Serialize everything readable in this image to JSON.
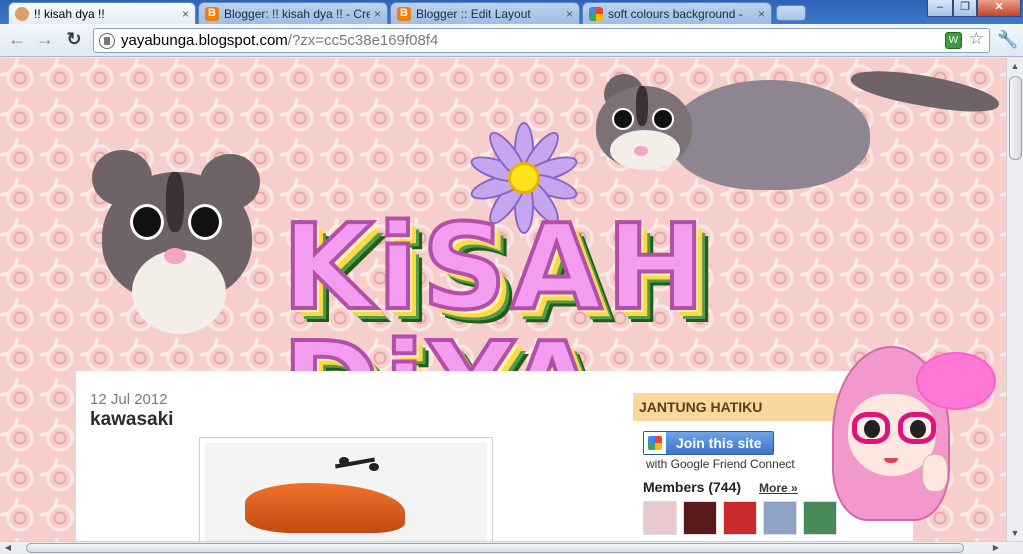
{
  "browser": {
    "tabs": [
      {
        "title": "!! kisah dya !!",
        "icon": "gnome-favicon",
        "active": true
      },
      {
        "title": "Blogger: !! kisah dya !! - Cre",
        "icon": "blogger-favicon",
        "active": false
      },
      {
        "title": "Blogger :: Edit Layout",
        "icon": "blogger-favicon",
        "active": false
      },
      {
        "title": "soft colours background -",
        "icon": "google-favicon",
        "active": false
      }
    ],
    "close_glyph": "×",
    "window": {
      "minimize": "–",
      "maximize": "❐",
      "close": "✕"
    },
    "nav": {
      "back": "←",
      "forward": "→",
      "reload": "↻",
      "wrench": "🔧"
    },
    "address": {
      "host": "yayabunga.blogspot.com",
      "path": "/?zx=cc5c38e169f08f4"
    },
    "star": "☆",
    "extension_glyph": "W"
  },
  "blog": {
    "header_title": "KiSAH DiYA",
    "post": {
      "date": "12 Jul 2012",
      "title": "kawasaki"
    },
    "sidebar": {
      "gadget_title": "JANTUNG HATIKU",
      "join_button": "Join this site",
      "gfc_caption": "with Google Friend Connect",
      "members_label": "Members (744)",
      "more_link": "More »",
      "member_colors": [
        "#e8c9cf",
        "#5a1a1a",
        "#c92b2b",
        "#8fa4c4",
        "#4a8a5a"
      ]
    }
  },
  "colors": {
    "tab_bar": "#3f78c9",
    "page_pattern": "#f6cfcd",
    "logo_fill": "#f49df0",
    "sidebar_title_bg": "#f9d79d"
  }
}
